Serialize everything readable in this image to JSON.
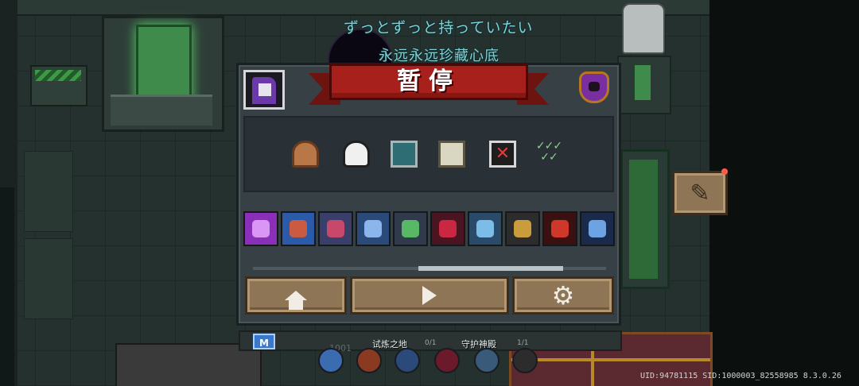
{
  "lyrics": {
    "japanese": "ずっとずっと持っていたい",
    "chinese": "永远永远珍藏心底"
  },
  "pause_menu": {
    "title": "暂停",
    "buffs": [
      {
        "icon": "helmet-icon"
      },
      {
        "icon": "ghost-icon"
      },
      {
        "icon": "maze-icon"
      },
      {
        "icon": "monitor-icon"
      },
      {
        "icon": "crossed-box-icon"
      },
      {
        "icon": "checkmarks-icon"
      }
    ],
    "skills": [
      {
        "icon": "lightning-skill-icon",
        "color": "#8a2fb8",
        "accent": "#e7a8ff"
      },
      {
        "icon": "sword-rain-skill-icon",
        "color": "#2a5aa8",
        "accent": "#e85a30"
      },
      {
        "icon": "balloons-skill-icon",
        "color": "#3a3f6a",
        "accent": "#e04a6a"
      },
      {
        "icon": "shield-skill-icon",
        "color": "#2a4a7a",
        "accent": "#9ec8ff"
      },
      {
        "icon": "tools-skill-icon",
        "color": "#2f3a4a",
        "accent": "#5fcf6a"
      },
      {
        "icon": "blood-drop-skill-icon",
        "color": "#4a1420",
        "accent": "#e02a4a"
      },
      {
        "icon": "ghost-blade-skill-icon",
        "color": "#2a4a6a",
        "accent": "#8ad0ff"
      },
      {
        "icon": "guns-skill-icon",
        "color": "#2c2c2c",
        "accent": "#e8b040"
      },
      {
        "icon": "flame-sword-skill-icon",
        "color": "#3a1010",
        "accent": "#e84030"
      },
      {
        "icon": "hourglass-skill-icon",
        "color": "#1a2a4a",
        "accent": "#7ab8ff"
      }
    ],
    "scroll_position": 0.47,
    "buttons": {
      "home": "home-icon",
      "resume": "play-icon",
      "settings": "gear-icon"
    }
  },
  "hud": {
    "rank_badge": "M",
    "area_1": "试炼之地",
    "area_1_count": "0/1",
    "area_2": "守护神殿",
    "area_2_count": "1/1",
    "level_number": "1001",
    "uid_line": "UID:94781115 SID:1000003_82558985 8.3.0.26"
  },
  "colors": {
    "banner_red": "#a8201c",
    "button_tan": "#8e7555",
    "panel_bg": "#364045",
    "lyric_cyan": "#7fd1d6"
  }
}
